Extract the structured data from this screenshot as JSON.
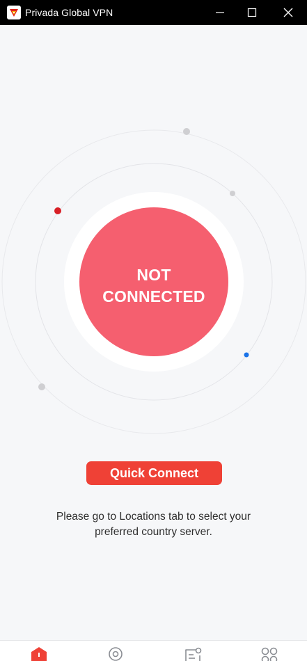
{
  "window": {
    "title": "Privada Global VPN",
    "controls": {
      "minimize_icon": "minimize-icon",
      "maximize_icon": "maximize-icon",
      "close_icon": "close-icon"
    }
  },
  "status": {
    "line1": "NOT",
    "line2": "CONNECTED"
  },
  "actions": {
    "quick_connect_label": "Quick Connect"
  },
  "hint": {
    "line1": "Please go to Locations tab to select your",
    "line2": "preferred country server."
  },
  "bottom_nav": {
    "items": [
      {
        "icon": "home-icon",
        "active": true
      },
      {
        "icon": "location-pin-icon",
        "active": false
      },
      {
        "icon": "split-tunnel-icon",
        "active": false
      },
      {
        "icon": "more-apps-icon",
        "active": false
      }
    ]
  },
  "colors": {
    "accent": "#ef4136",
    "status_not_connected": "#f55f6f",
    "orbit_dot_red": "#d81f26",
    "orbit_dot_blue": "#1a73e8",
    "orbit_dot_gray": "#cfcfd2",
    "background": "#f6f7f9",
    "titlebar": "#000000"
  }
}
